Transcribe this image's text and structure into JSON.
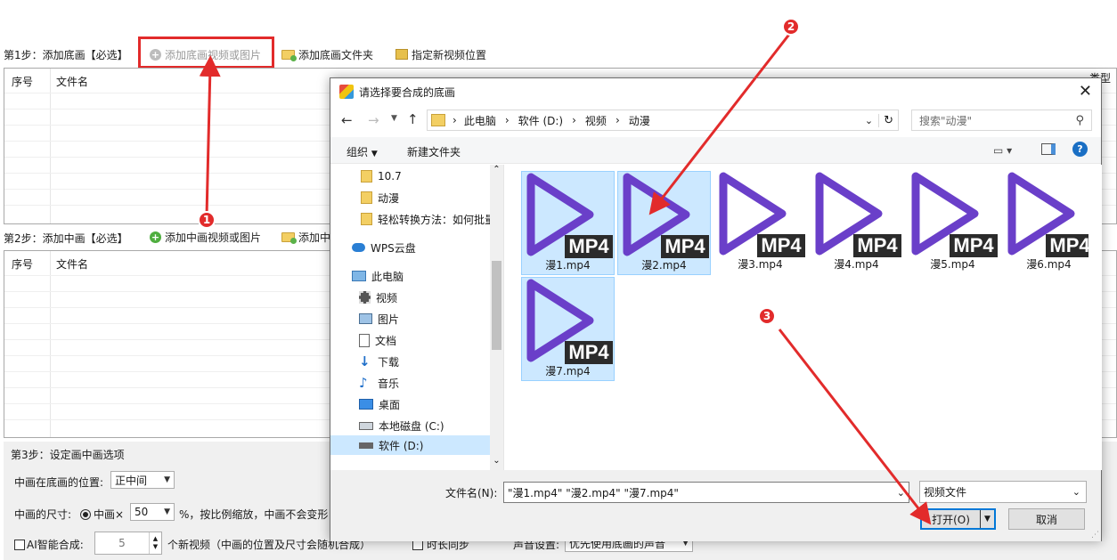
{
  "step1": {
    "label": "第1步：添加底画【必选】",
    "add_video_btn": "添加底画视频或图片",
    "add_folder_btn": "添加底画文件夹",
    "set_location_btn": "指定新视频位置",
    "col_index": "序号",
    "col_filename": "文件名",
    "col_type_partial": "类型"
  },
  "step2": {
    "label": "第2步：添加中画【必选】",
    "add_video_btn": "添加中画视频或图片",
    "add_folder_btn_partial": "添加中画",
    "col_index": "序号",
    "col_filename": "文件名"
  },
  "step3": {
    "label": "第3步：设定画中画选项",
    "position_label": "中画在底画的位置:",
    "position_value": "正中间",
    "size_label": "中画的尺寸:",
    "size_radio": "中画×",
    "size_value": "50",
    "size_hint": "%，按比例缩放，中画不会变形",
    "ai_checkbox": "AI智能合成:",
    "ai_count": "5",
    "ai_hint": "个新视频（中画的位置及尺寸会随机合成）",
    "sync_checkbox": "时长同步",
    "audio_label": "声音设置:",
    "audio_value": "优先使用底画的声音"
  },
  "dialog": {
    "title": "请选择要合成的底画",
    "breadcrumb": [
      "此电脑",
      "软件 (D:)",
      "视频",
      "动漫"
    ],
    "search_placeholder": "搜索\"动漫\"",
    "organize": "组织",
    "new_folder": "新建文件夹",
    "nav_items": [
      {
        "label": "10.7",
        "icon": "folder-icon"
      },
      {
        "label": "动漫",
        "icon": "folder-icon"
      },
      {
        "label": "轻松转换方法：如何批量",
        "icon": "folder-icon"
      },
      {
        "label": "WPS云盘",
        "icon": "cloud-icon"
      },
      {
        "label": "此电脑",
        "icon": "computer-icon"
      },
      {
        "label": "视频",
        "icon": "video-icon"
      },
      {
        "label": "图片",
        "icon": "picture-icon"
      },
      {
        "label": "文档",
        "icon": "document-icon"
      },
      {
        "label": "下载",
        "icon": "download-icon"
      },
      {
        "label": "音乐",
        "icon": "music-icon"
      },
      {
        "label": "桌面",
        "icon": "desktop-icon"
      },
      {
        "label": "本地磁盘 (C:)",
        "icon": "drive-icon"
      },
      {
        "label": "软件 (D:)",
        "icon": "drive-icon"
      }
    ],
    "files": [
      {
        "name": "漫1.mp4",
        "selected": true
      },
      {
        "name": "漫2.mp4",
        "selected": true
      },
      {
        "name": "漫3.mp4",
        "selected": false
      },
      {
        "name": "漫4.mp4",
        "selected": false
      },
      {
        "name": "漫5.mp4",
        "selected": false
      },
      {
        "name": "漫6.mp4",
        "selected": false
      },
      {
        "name": "漫7.mp4",
        "selected": true
      }
    ],
    "file_badge": "MP4",
    "filename_label": "文件名(N):",
    "filename_value": "\"漫1.mp4\" \"漫2.mp4\" \"漫7.mp4\"",
    "filetype_value": "视频文件",
    "open_btn": "打开(O)",
    "cancel_btn": "取消"
  },
  "annotations": [
    "1",
    "2",
    "3"
  ],
  "colors": {
    "annotation_red": "#e22b2b",
    "play_purple": "#6a3fc9",
    "selection_blue": "#cce8ff"
  }
}
